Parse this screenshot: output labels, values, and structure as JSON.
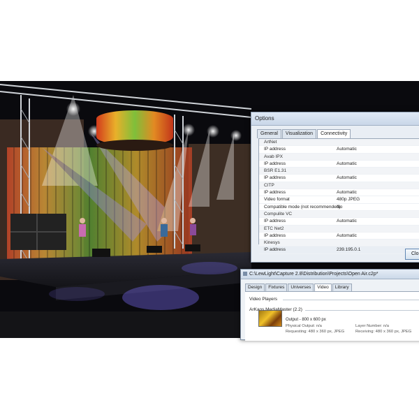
{
  "options_dialog": {
    "title": "Options",
    "tabs": [
      "General",
      "Visualization",
      "Connectivity"
    ],
    "active_tab": "Connectivity",
    "rows": [
      {
        "type": "header",
        "label": "ArtNet"
      },
      {
        "type": "field",
        "key": "IP address",
        "value": "Automatic"
      },
      {
        "type": "header",
        "label": "Avab IPX"
      },
      {
        "type": "field",
        "key": "IP address",
        "value": "Automatic"
      },
      {
        "type": "header",
        "label": "BSR E1.31"
      },
      {
        "type": "field",
        "key": "IP address",
        "value": "Automatic"
      },
      {
        "type": "header",
        "label": "CITP"
      },
      {
        "type": "field",
        "key": "IP address",
        "value": "Automatic"
      },
      {
        "type": "field",
        "key": "Video format",
        "value": "480p JPEG"
      },
      {
        "type": "field",
        "key": "Compatible mode (not recommended)",
        "value": "No"
      },
      {
        "type": "header",
        "label": "Compulite VC"
      },
      {
        "type": "field",
        "key": "IP address",
        "value": "Automatic"
      },
      {
        "type": "header",
        "label": "ETC Net2"
      },
      {
        "type": "field",
        "key": "IP address",
        "value": "Automatic"
      },
      {
        "type": "header",
        "label": "Kinesys"
      },
      {
        "type": "field",
        "key": "IP address",
        "value": "239.195.0.1"
      }
    ],
    "button_label": "Clo"
  },
  "capture_window": {
    "title": "C:\\LewLight\\Capture 2.8\\Distribution\\Projects\\Open Air.c2p*",
    "tabs": [
      "Design",
      "Fixtures",
      "Universes",
      "Video",
      "Library"
    ],
    "active_tab": "Video",
    "section_title": "Video Players",
    "player_name": "ArKaos MediaMaster (2.2)",
    "output_label": "Output - 800 x 600 px",
    "physical_output": "Physical Output: n/a",
    "requesting": "Requesting: 480 x 360 px, JPEG",
    "layer_number": "Layer Number: n/a",
    "receiving": "Receiving: 480 x 360 px, JPEG"
  }
}
